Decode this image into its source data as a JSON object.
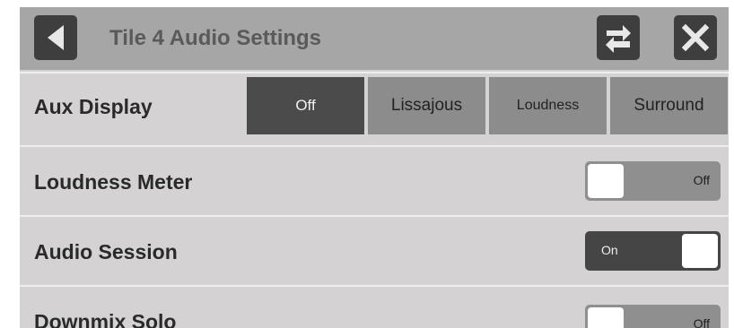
{
  "header": {
    "title": "Tile 4 Audio Settings",
    "back_icon": "back-triangle-icon",
    "swap_icon": "swap-arrows-icon",
    "close_icon": "close-x-icon"
  },
  "aux_display": {
    "label": "Aux Display",
    "options": [
      "Off",
      "Lissajous",
      "Loudness",
      "Surround"
    ],
    "selected": "Off"
  },
  "loudness_meter": {
    "label": "Loudness Meter",
    "state": "Off"
  },
  "audio_session": {
    "label": "Audio Session",
    "state": "On"
  },
  "downmix_solo": {
    "label": "Downmix Solo",
    "state": "Off"
  },
  "colors": {
    "header_bg": "#a6a6a6",
    "panel_bg": "#d4d2d2",
    "active_segment": "#4b4b4b",
    "inactive_segment": "#8c8c8c"
  }
}
